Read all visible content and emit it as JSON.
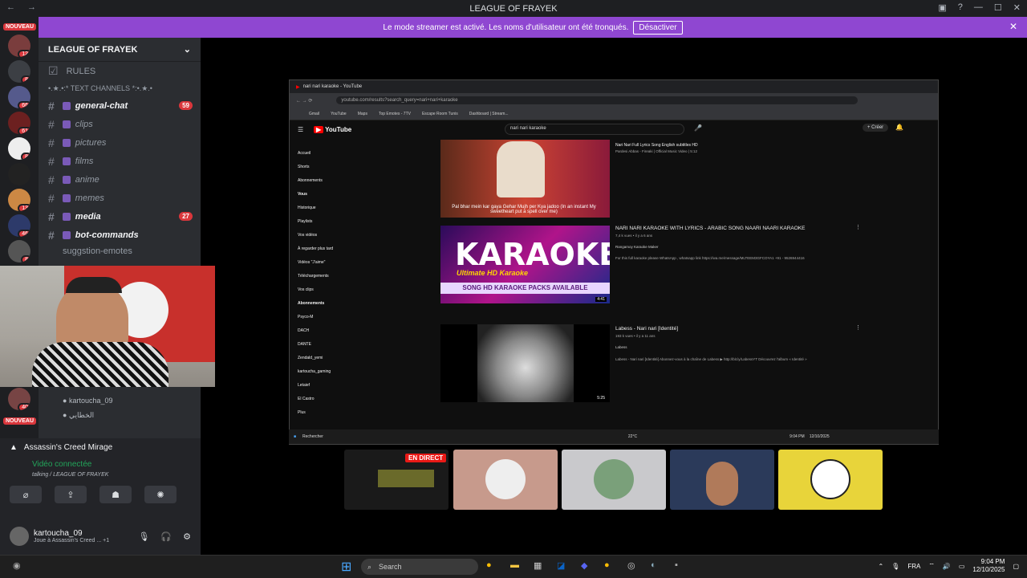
{
  "window": {
    "title": "LEAGUE OF FRAYEK"
  },
  "banner": {
    "text": "Le mode streamer est activé. Les noms d'utilisateur ont été tronqués.",
    "button": "Désactiver"
  },
  "servers": {
    "new_label": "NOUVEAU",
    "badges": [
      "12",
      "8",
      "66",
      "61",
      "8",
      "13",
      "46",
      "8",
      "13",
      "40"
    ]
  },
  "server_panel": {
    "name": "LEAGUE OF FRAYEK",
    "rules": "RULES",
    "section": "•.★.•:* TEXT CHANNELS *:•.★.•",
    "channels": [
      {
        "name": "general-chat",
        "count": "59",
        "bold": true
      },
      {
        "name": "clips",
        "count": "",
        "bold": false
      },
      {
        "name": "pictures",
        "count": "",
        "bold": false
      },
      {
        "name": "films",
        "count": "",
        "bold": false
      },
      {
        "name": "anime",
        "count": "",
        "bold": false
      },
      {
        "name": "memes",
        "count": "",
        "bold": false
      },
      {
        "name": "media",
        "count": "27",
        "bold": true
      },
      {
        "name": "bot-commands",
        "count": "",
        "bold": true
      }
    ],
    "last": "suggstion-emotes"
  },
  "voice_users": [
    "kartoucha_09",
    "الخطايي"
  ],
  "activity": {
    "game": "Assassin's Creed Mirage",
    "status": "Vidéo connectée",
    "channel": "talking / LEAGUE OF FRAYEK"
  },
  "user": {
    "name": "kartoucha_09",
    "status": "Joue à Assassin's Creed ... +1"
  },
  "browser": {
    "tab": "nari nari karaoke - YouTube",
    "url": "youtube.com/results?search_query=nari+nari+karaoke",
    "bookmarks": [
      "Gmail",
      "YouTube",
      "Maps",
      "Top Emotes - 7TV",
      "Escape Room Tunis",
      "Dashboard | Stream..."
    ],
    "search": "nari nari karaoke",
    "create": "Créer",
    "sidebar": [
      "Accueil",
      "Shorts",
      "Abonnements",
      "Vous",
      "Historique",
      "Playlists",
      "Vos vidéos",
      "À regarder plus tard",
      "Vidéos \"J'aime\"",
      "Téléchargements",
      "Vos clips",
      "Abonnements",
      "Psyco-M",
      "DACH",
      "DANTE",
      "Zendald_yemi",
      "kartoucha_gaming",
      "Letaief",
      "El Castro",
      "Plus"
    ],
    "videos": [
      {
        "title": "Nari Nari Full Lyrics Song English subtitles HD",
        "meta": "Pardesi Abbas - Fireaki | Official Music Video | 5:12",
        "caption": "Pal bhar mein kar gaya Gehar Mujh per Kya jadoo (In an instant My sweetheart put a spell over me)",
        "dur": ""
      },
      {
        "title": "NARI NARI KARAOKE WITH LYRICS - ARABIC SONG NAARI NAARI KARAOKE",
        "meta": "7,4 k vues • il y a 6 ans",
        "channel": "Rangamoy Karaoke Maker",
        "desc": "For this full karaoke please WhatsApp , whatsapp link https://wa.me/message/MLTEEM3GFCOYA1 +91 - 9526944416",
        "dur": "4:41",
        "thumb_title": "KARAOKE",
        "thumb_sub": "Ultimate HD Karaoke",
        "thumb_banner": "SONG HD KARAOKE PACKS AVAILABLE"
      },
      {
        "title": "Labess - Nari nari [Identité]",
        "meta": "193 k vues • il y a 11 ans",
        "channel": "Labess",
        "desc": "Labess - Nari nari [Identité] Abonnez-vous à la chaîne de Labess ▶ http://bit.ly/LabessYT Découvrez l'album « Identité »",
        "dur": "5:25"
      }
    ],
    "taskbar_search": "Rechercher",
    "weather": "22°C",
    "clock": "9:04 PM",
    "date": "12/10/2025"
  },
  "stream": {
    "live": "EN DIRECT"
  },
  "taskbar": {
    "search": "Search",
    "lang": "FRA",
    "time": "9:04 PM",
    "date": "12/10/2025"
  },
  "colors": {
    "accent": "#8f47d1",
    "discord_red": "#da373c",
    "yt_red": "#ff0000",
    "live_red": "#e91916"
  }
}
